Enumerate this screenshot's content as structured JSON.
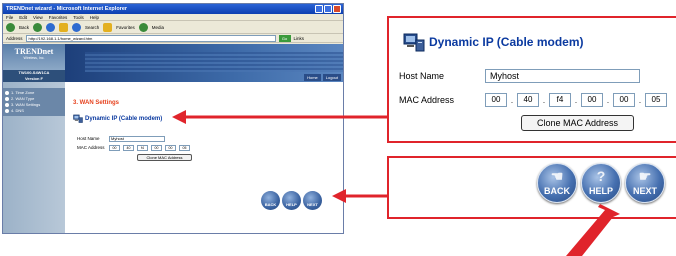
{
  "browser": {
    "title": "TRENDnet wizard - Microsoft Internet Explorer",
    "menu": [
      "File",
      "Edit",
      "View",
      "Favorites",
      "Tools",
      "Help"
    ],
    "toolbar": {
      "back": "Back",
      "search": "Search",
      "favorites": "Favorites",
      "media": "Media"
    },
    "address_label": "Address",
    "address_value": "http://192.168.1.1/home_wizard.htm",
    "go_label": "Go",
    "links_label": "Links"
  },
  "router_page": {
    "logo": "TRENDnet",
    "logo_tagline": "Wireless, Inc.",
    "model": "TW100-S4W1CA",
    "model_sub": "Version F",
    "steps": [
      "1. Time Zone",
      "2. WAN Type",
      "3. WAN Settings",
      "4. DNS"
    ],
    "banner_tabs": [
      "Home",
      "Logout"
    ],
    "section_title": "3. WAN Settings",
    "heading": "Dynamic IP (Cable modem)",
    "host_name_label": "Host Name",
    "host_name_value": "Myhost",
    "mac_label": "MAC Address",
    "mac_octets": [
      "00",
      "40",
      "f4",
      "00",
      "00",
      "05"
    ],
    "clone_button": "Clone MAC Address",
    "nav": {
      "back": "BACK",
      "help": "HELP",
      "next": "NEXT"
    }
  },
  "zoom_form": {
    "heading": "Dynamic IP (Cable modem)",
    "host_name_label": "Host Name",
    "host_name_value": "Myhost",
    "mac_label": "MAC Address",
    "mac_octets": [
      "00",
      "40",
      "f4",
      "00",
      "00",
      "05"
    ],
    "clone_button": "Clone MAC Address"
  },
  "zoom_nav": {
    "back": "BACK",
    "help": "HELP",
    "next": "NEXT"
  },
  "colors": {
    "callout_red": "#e0242b",
    "heading_blue": "#0b3aa0",
    "section_orange": "#e6421e",
    "nav_blue": "#4670b0"
  }
}
